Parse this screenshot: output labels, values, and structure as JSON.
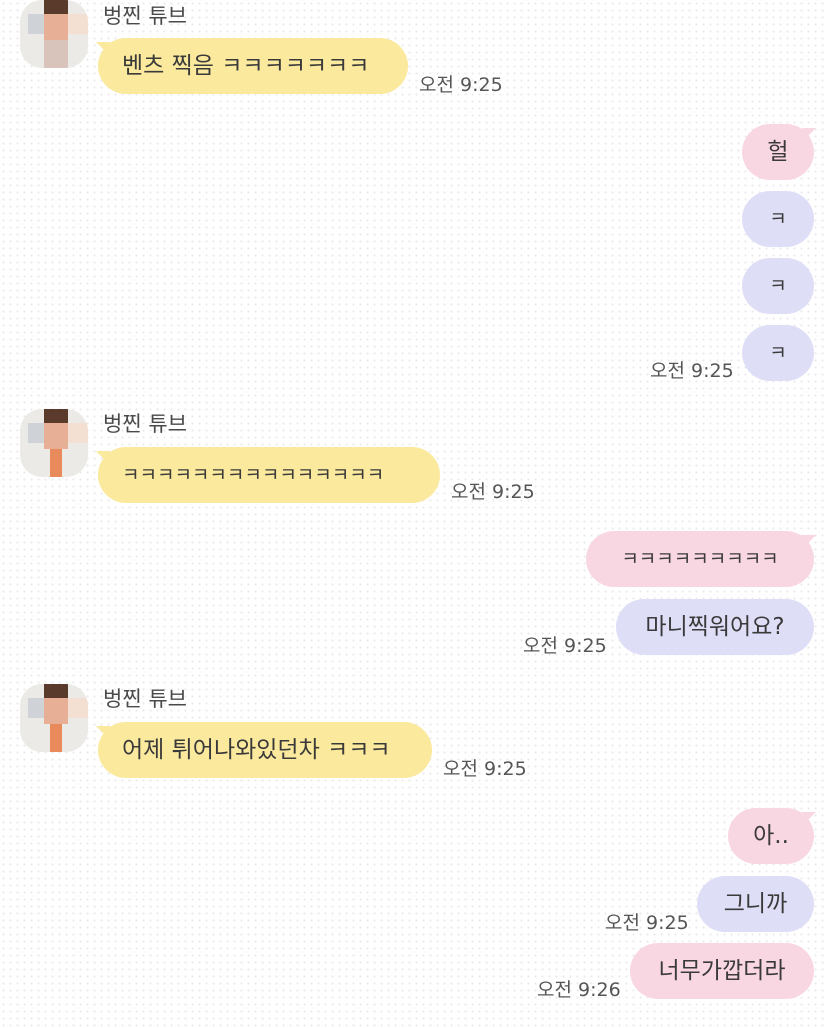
{
  "contact": {
    "name": "벙찐 튜브"
  },
  "messages": [
    {
      "id": "m1",
      "direction": "in",
      "text": "벤츠 찍음 ㅋㅋㅋㅋㅋㅋㅋ",
      "time": "오전 9:25"
    },
    {
      "id": "m2",
      "direction": "out",
      "text": "헐",
      "color": "pink"
    },
    {
      "id": "m3",
      "direction": "out",
      "text": "ㅋ",
      "color": "lavender"
    },
    {
      "id": "m4",
      "direction": "out",
      "text": "ㅋ",
      "color": "lavender"
    },
    {
      "id": "m5",
      "direction": "out",
      "text": "ㅋ",
      "color": "lavender",
      "time": "오전 9:25"
    },
    {
      "id": "m6",
      "direction": "in",
      "text": "ㅋㅋㅋㅋㅋㅋㅋㅋㅋㅋㅋㅋㅋㅋㅋ",
      "time": "오전 9:25"
    },
    {
      "id": "m7",
      "direction": "out",
      "text": "ㅋㅋㅋㅋㅋㅋㅋㅋㅋ",
      "color": "pink"
    },
    {
      "id": "m8",
      "direction": "out",
      "text": "마니찍워어요?",
      "color": "lavender",
      "time": "오전 9:25"
    },
    {
      "id": "m9",
      "direction": "in",
      "text": "어제 튀어나와있던차 ㅋㅋㅋ",
      "time": "오전 9:25"
    },
    {
      "id": "m10",
      "direction": "out",
      "text": "아..",
      "color": "pink"
    },
    {
      "id": "m11",
      "direction": "out",
      "text": "그니까",
      "color": "lavender",
      "time": "오전 9:25"
    },
    {
      "id": "m12",
      "direction": "out",
      "text": "너무가깝더라",
      "color": "pink",
      "time": "오전 9:26"
    }
  ],
  "colors": {
    "incoming_bubble": "#fbe99d",
    "outgoing_pink": "#f9d7e2",
    "outgoing_lavender": "#dfdef7",
    "background": "#ffffff"
  },
  "icons": {
    "avatar": "pixelated-profile-avatar"
  }
}
